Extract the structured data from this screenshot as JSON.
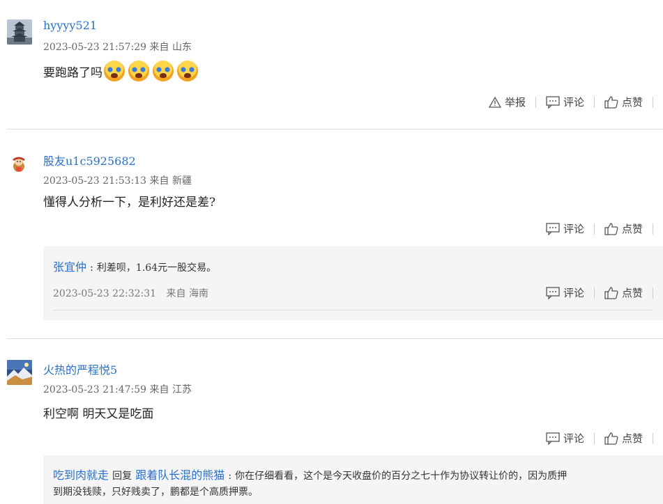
{
  "comments": [
    {
      "username": "hyyyy521",
      "time": "2023-05-23 21:57:29",
      "from_label": "来自",
      "location": "山东",
      "text": "要跑路了吗",
      "emoji_count": 4,
      "emoji_icon": "crying-face-icon",
      "actions": {
        "report": "举报",
        "comment": "评论",
        "like": "点赞"
      }
    },
    {
      "username": "股友u1c5925682",
      "time": "2023-05-23 21:53:13",
      "from_label": "来自",
      "location": "新疆",
      "text": "懂得人分析一下，是利好还是差?",
      "actions": {
        "comment": "评论",
        "like": "点赞"
      },
      "reply": {
        "username": "张宜仲",
        "separator": ":",
        "text": "利差呗，1.64元一股交易。",
        "time": "2023-05-23 22:32:31",
        "from_label": "来自",
        "location": "海南",
        "actions": {
          "comment": "评论",
          "like": "点赞"
        }
      }
    },
    {
      "username": "火热的严程悦5",
      "time": "2023-05-23 21:47:59",
      "from_label": "来自",
      "location": "江苏",
      "text": "利空啊 明天又是吃面",
      "actions": {
        "comment": "评论",
        "like": "点赞"
      },
      "reply": {
        "username": "吃到肉就走",
        "reply_word": "回复",
        "reply_to": "跟着队长混的熊猫",
        "separator": ":",
        "text_line1": "你在仔细看看，这个是今天收盘价的百分之七十作为协议转让价的，因为质押",
        "text_line2": "到期没钱赎，只好贱卖了，鹏都是个高质押票。"
      }
    }
  ],
  "colors": {
    "link": "#2a6fc9",
    "reply_bg": "#f5f5f5",
    "divider": "#dcdcdc"
  }
}
